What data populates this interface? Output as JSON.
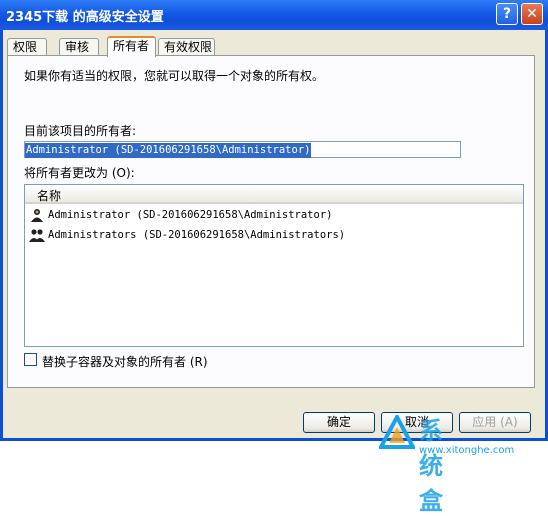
{
  "window": {
    "title": "2345下载 的高级安全设置",
    "help_label": "?",
    "close_label": "✕"
  },
  "tabs": [
    {
      "label": "权限",
      "active": false
    },
    {
      "label": "审核",
      "active": false
    },
    {
      "label": "所有者",
      "active": true
    },
    {
      "label": "有效权限",
      "active": false
    }
  ],
  "owner_tab": {
    "intro_text": "如果你有适当的权限，您就可以取得一个对象的所有权。",
    "current_owner_label": "目前该项目的所有者:",
    "current_owner_value": "Administrator (SD-201606291658\\Administrator)",
    "change_owner_label": "将所有者更改为 (O):",
    "list_header_name": "名称",
    "owners": [
      {
        "name": "Administrator (SD-201606291658\\Administrator)",
        "icon": "user-icon"
      },
      {
        "name": "Administrators (SD-201606291658\\Administrators)",
        "icon": "group-icon"
      }
    ],
    "replace_checkbox_label": "替换子容器及对象的所有者 (R)",
    "replace_checked": false
  },
  "buttons": {
    "ok": "确定",
    "cancel": "取消",
    "apply": "应用 (A)"
  },
  "watermark": {
    "text": "系统盒",
    "url": "www.xitonghe.com"
  }
}
